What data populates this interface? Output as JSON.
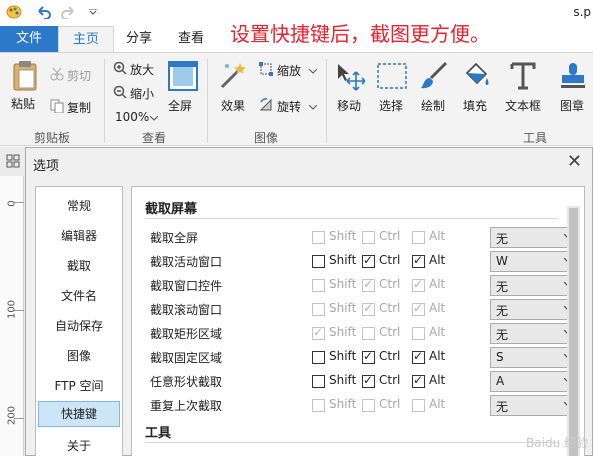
{
  "title": "s.p",
  "caption": "设置快捷键后，截图更方便。",
  "tabs": {
    "file": "文件",
    "home": "主页",
    "share": "分享",
    "view": "查看"
  },
  "ribbon": {
    "paste": "粘贴",
    "cut": "剪切",
    "copy": "复制",
    "clipboard": "剪贴板",
    "zoom_in": "放大",
    "zoom_out": "缩小",
    "zoom_level": "100%",
    "fullscreen": "全屏",
    "view_group": "查看",
    "effects": "效果",
    "resize": "缩放",
    "rotate": "旋转",
    "image_group": "图像",
    "move": "移动",
    "select": "选择",
    "draw": "绘制",
    "fill": "填充",
    "textbox": "文本框",
    "stamp": "图章",
    "tools_group": "工具"
  },
  "ruler": [
    "0",
    "100",
    "200"
  ],
  "dialog": {
    "title": "选项",
    "nav": [
      "常规",
      "编辑器",
      "截取",
      "文件名",
      "自动保存",
      "图像",
      "FTP 空间",
      "快捷键",
      "关于"
    ],
    "selected_nav": "快捷键",
    "section1": "截取屏幕",
    "section2": "工具",
    "mods": {
      "shift": "Shift",
      "ctrl": "Ctrl",
      "alt": "Alt"
    },
    "rows": [
      {
        "label": "截取全屏",
        "shift": false,
        "ctrl": false,
        "alt": false,
        "enabled": false,
        "key": "无"
      },
      {
        "label": "截取活动窗口",
        "shift": false,
        "ctrl": true,
        "alt": true,
        "enabled": true,
        "key": "W"
      },
      {
        "label": "截取窗口控件",
        "shift": false,
        "ctrl": true,
        "alt": true,
        "enabled": false,
        "key": "无"
      },
      {
        "label": "截取滚动窗口",
        "shift": false,
        "ctrl": true,
        "alt": true,
        "enabled": false,
        "key": "无"
      },
      {
        "label": "截取矩形区域",
        "shift": true,
        "ctrl": false,
        "alt": false,
        "enabled": false,
        "key": "无"
      },
      {
        "label": "截取固定区域",
        "shift": false,
        "ctrl": true,
        "alt": true,
        "enabled": true,
        "key": "S"
      },
      {
        "label": "任意形状截取",
        "shift": false,
        "ctrl": true,
        "alt": true,
        "enabled": true,
        "key": "A"
      },
      {
        "label": "重复上次截取",
        "shift": false,
        "ctrl": false,
        "alt": false,
        "enabled": false,
        "key": "无"
      }
    ]
  },
  "watermark": "Baidu 经验",
  "colors": {
    "accent": "#2b79c8",
    "caption": "#e8222f"
  }
}
